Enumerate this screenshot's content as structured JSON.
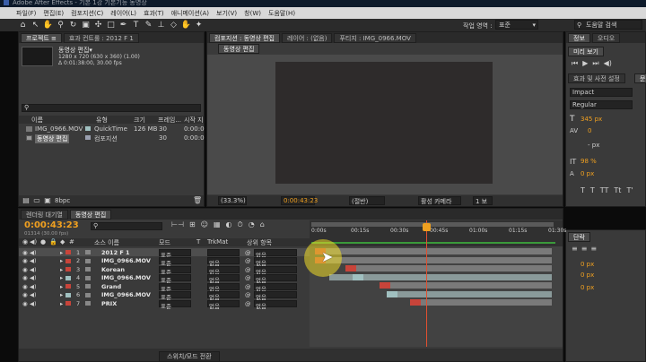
{
  "title_bar": {
    "text": "Adobe After Effects - 기본 1강 기본기능 동영상"
  },
  "menu": [
    "파일(F)",
    "편집(E)",
    "컴포지션(C)",
    "레이어(L)",
    "효과(T)",
    "애니메이션(A)",
    "보기(V)",
    "창(W)",
    "도움말(H)"
  ],
  "workspace": {
    "label": "작업 영역 :",
    "value": "표준"
  },
  "help_search": {
    "placeholder": "도움말 검색"
  },
  "project": {
    "tabs": [
      "프로젝트 ≡",
      "효과 컨트롤 : 2012 F 1"
    ],
    "comp_name": "동영상 편집▾",
    "comp_info": [
      "1280 x 720  (630 x 360) (1.00)",
      "Δ 0:01:38:00, 30.00 fps"
    ],
    "search_placeholder": "",
    "columns": [
      "이름",
      "유형",
      "크기",
      "프레임...",
      "시작 지"
    ],
    "items": [
      {
        "name": "IMG_0966.MOV",
        "type": "QuickTime",
        "size": "126 MB",
        "fps": "30",
        "start": "0:00:0"
      },
      {
        "name": "동영상 편집",
        "type": "컴포지션",
        "size": "",
        "fps": "30",
        "start": "0:00:0"
      }
    ],
    "bpc": "8bpc"
  },
  "composition": {
    "tabs": [
      "컴포지션 : 동영상 편집",
      "레이어 : (없음)",
      "푸티지 : IMG_0966.MOV"
    ],
    "subtab": "동영상 편집",
    "footer": {
      "zoom": "(33.3%)",
      "time": "0:00:43:23",
      "res": "(절반)",
      "camera": "활성 카메라",
      "views": "1 보"
    }
  },
  "right_panel": {
    "tabs": [
      "정보",
      "오디오"
    ],
    "preview_tab": "미리 보기",
    "effects_tab": "효과 및 사전 설정",
    "char_tab": "문",
    "font": "Impact",
    "style": "Regular",
    "size_val": "345 px",
    "kerning": "0",
    "leading": "- px",
    "scale_v": "98 %",
    "scale_h": "0 %",
    "baseline": "0 px",
    "tsume": "0 %",
    "para_tab": "단락",
    "para_vals": [
      "0 px",
      "0 px",
      "0 px"
    ]
  },
  "timeline": {
    "tabs": [
      "렌더링 대기열",
      "동영상 편집"
    ],
    "timecode": "0:00:43:23",
    "frame_info": "01314 (30.00 fps)",
    "columns": {
      "src": "소스 이름",
      "mode": "모드",
      "t": "T",
      "trkmat": "TrkMat",
      "parent": "상위 항목"
    },
    "ruler": [
      "0:00s",
      "00:15s",
      "00:30s",
      "00:45s",
      "01:00s",
      "01:15s",
      "01:30s"
    ],
    "layers": [
      {
        "num": "1",
        "name": "2012 F 1",
        "mode": "표준",
        "trkmat": "",
        "parent": "없음",
        "color": "#c8443a"
      },
      {
        "num": "2",
        "name": "IMG_0966.MOV",
        "mode": "표준",
        "trkmat": "없음",
        "parent": "없음",
        "color": "#c8443a"
      },
      {
        "num": "3",
        "name": "Korean",
        "mode": "표준",
        "trkmat": "없음",
        "parent": "없음",
        "color": "#c8443a"
      },
      {
        "num": "4",
        "name": "IMG_0966.MOV",
        "mode": "표준",
        "trkmat": "없음",
        "parent": "없음",
        "color": "#a0c0c0"
      },
      {
        "num": "5",
        "name": "Grand",
        "mode": "표준",
        "trkmat": "없음",
        "parent": "없음",
        "color": "#c8443a"
      },
      {
        "num": "6",
        "name": "IMG_0966.MOV",
        "mode": "표준",
        "trkmat": "없음",
        "parent": "없음",
        "color": "#a0c0c0"
      },
      {
        "num": "7",
        "name": "PRIX",
        "mode": "표준",
        "trkmat": "없음",
        "parent": "없음",
        "color": "#c8443a"
      }
    ],
    "toggle_label": "스위치/모드 전환"
  },
  "colors": {
    "accent": "#f0a020",
    "playhead": "#e05030",
    "bg": "#3a3a3a"
  }
}
